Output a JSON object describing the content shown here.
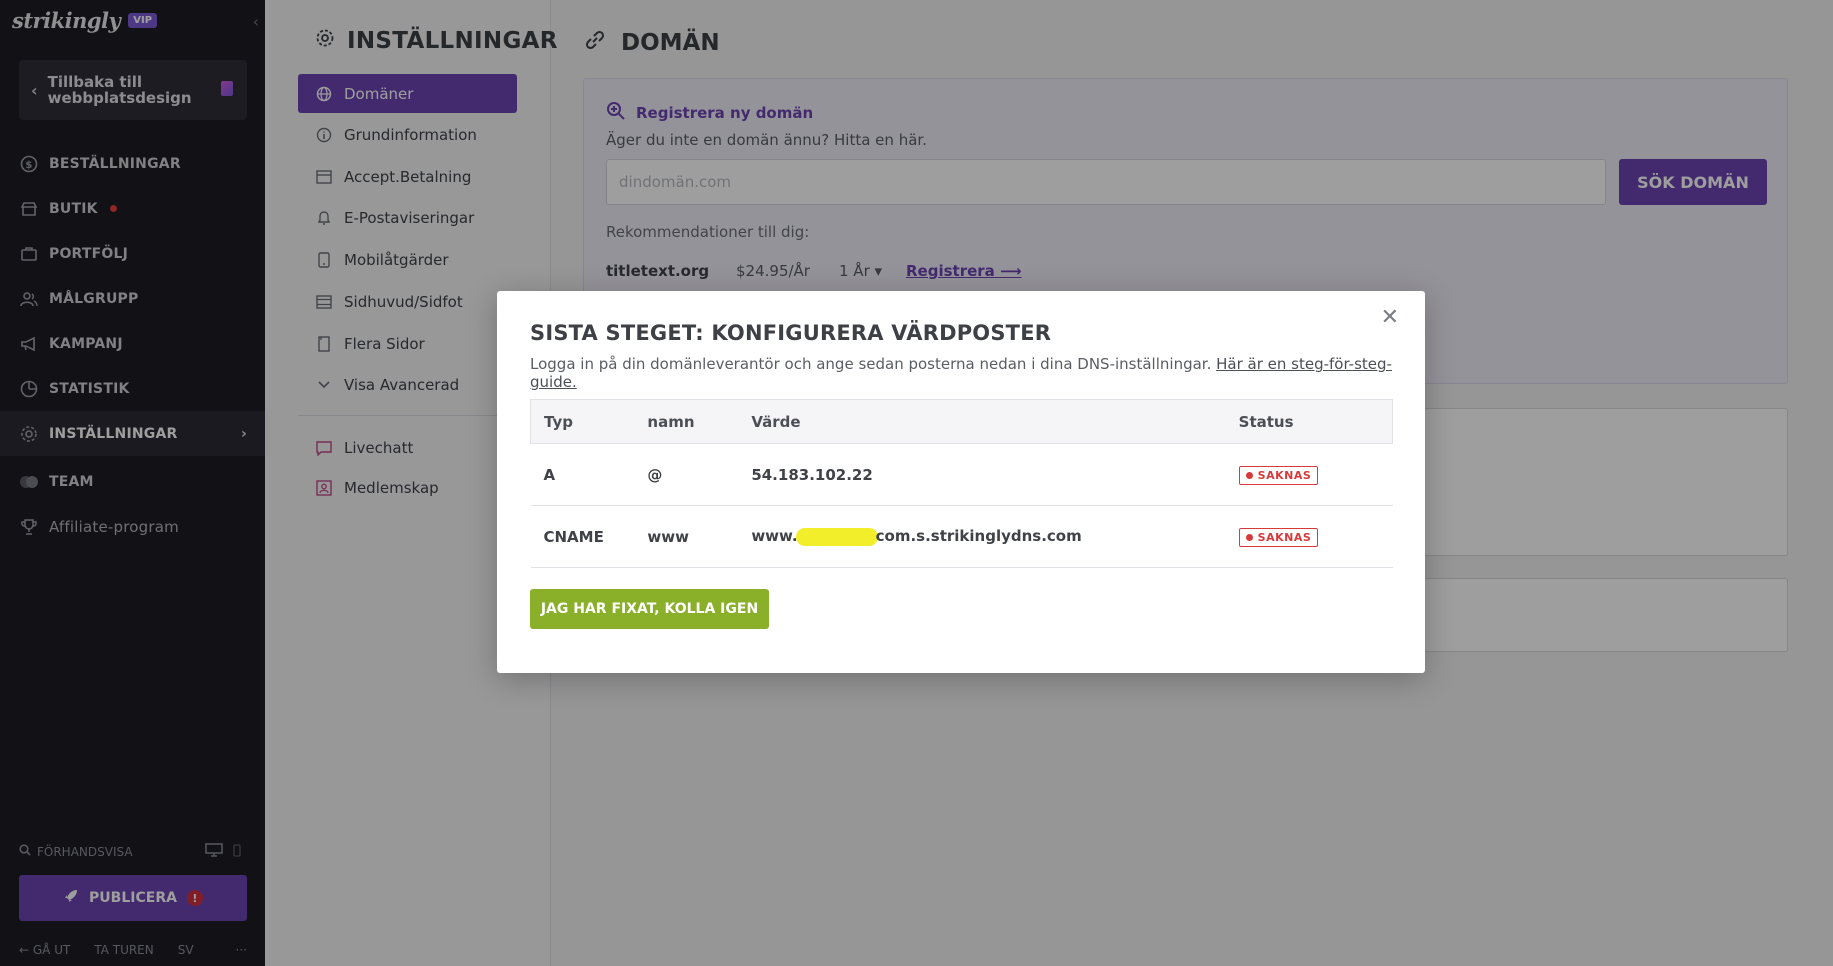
{
  "sidebar": {
    "logo": "strikingly",
    "vip_badge": "VIP",
    "back_label": "Tillbaka till webbplatsdesign",
    "items": [
      {
        "label": "BESTÄLLNINGAR",
        "icon": "dollar-icon"
      },
      {
        "label": "BUTIK",
        "icon": "store-icon"
      },
      {
        "label": "PORTFÖLJ",
        "icon": "briefcase-icon"
      },
      {
        "label": "MÅLGRUPP",
        "icon": "users-icon"
      },
      {
        "label": "KAMPANJ",
        "icon": "megaphone-icon"
      },
      {
        "label": "STATISTIK",
        "icon": "chart-icon"
      },
      {
        "label": "INSTÄLLNINGAR",
        "icon": "gear-icon"
      },
      {
        "label": "TEAM",
        "icon": "team-icon"
      },
      {
        "label": "Affiliate-program",
        "icon": "trophy-icon"
      }
    ],
    "preview_label": "FÖRHANDSVISA",
    "publish_label": "PUBLICERA",
    "footer": {
      "logout": "GÅ UT",
      "tour": "TA TUREN",
      "lang": "SV",
      "more": "···"
    }
  },
  "submenu": {
    "title": "INSTÄLLNINGAR",
    "items": [
      {
        "label": "Domäner",
        "icon": "globe-icon"
      },
      {
        "label": "Grundinformation",
        "icon": "info-icon"
      },
      {
        "label": "Accept.Betalning",
        "icon": "card-icon"
      },
      {
        "label": "E-Postaviseringar",
        "icon": "bell-icon"
      },
      {
        "label": "Mobilåtgärder",
        "icon": "mobile-icon"
      },
      {
        "label": "Sidhuvud/Sidfot",
        "icon": "layout-icon"
      },
      {
        "label": "Flera Sidor",
        "icon": "pages-icon"
      },
      {
        "label": "Visa Avancerad",
        "icon": "chevron-down-icon"
      },
      {
        "label": "Livechatt",
        "icon": "chat-icon"
      },
      {
        "label": "Medlemskap",
        "icon": "member-icon"
      }
    ]
  },
  "main": {
    "title": "DOMÄN",
    "register_title": "Registrera ny domän",
    "register_sub": "Äger du inte en domän ännu? Hitta en här.",
    "search_placeholder": "dindomän.com",
    "search_button": "SÖK DOMÄN",
    "recommend_label": "Rekommendationer till dig:",
    "recommendation": {
      "domain": "titletext.org",
      "price": "$24.95/År",
      "period": "1 År",
      "action": "Registrera"
    }
  },
  "modal": {
    "title": "SISTA STEGET: KONFIGURERA VÄRDPOSTER",
    "subtitle": "Logga in på din domänleverantör och ange sedan posterna nedan i dina DNS-inställningar.",
    "guide_link": "Här är en steg-för-steg-guide.",
    "columns": [
      "Typ",
      "namn",
      "Värde",
      "Status"
    ],
    "rows": [
      {
        "type": "A",
        "name": "@",
        "value": "54.183.102.22",
        "status": "SAKNAS"
      },
      {
        "type": "CNAME",
        "name": "www",
        "value_prefix": "www.",
        "value_suffix": "com.s.strikinglydns.com",
        "status": "SAKNAS"
      }
    ],
    "check_button": "JAG HAR FIXAT, KOLLA IGEN",
    "close_icon": "close-icon"
  },
  "colors": {
    "sidebar_bg": "#1c1c24",
    "accent_purple": "#6d45b3",
    "action_green": "#8ab02a",
    "missing_red": "#d63a3a",
    "redaction_yellow": "#f3ee2a"
  }
}
